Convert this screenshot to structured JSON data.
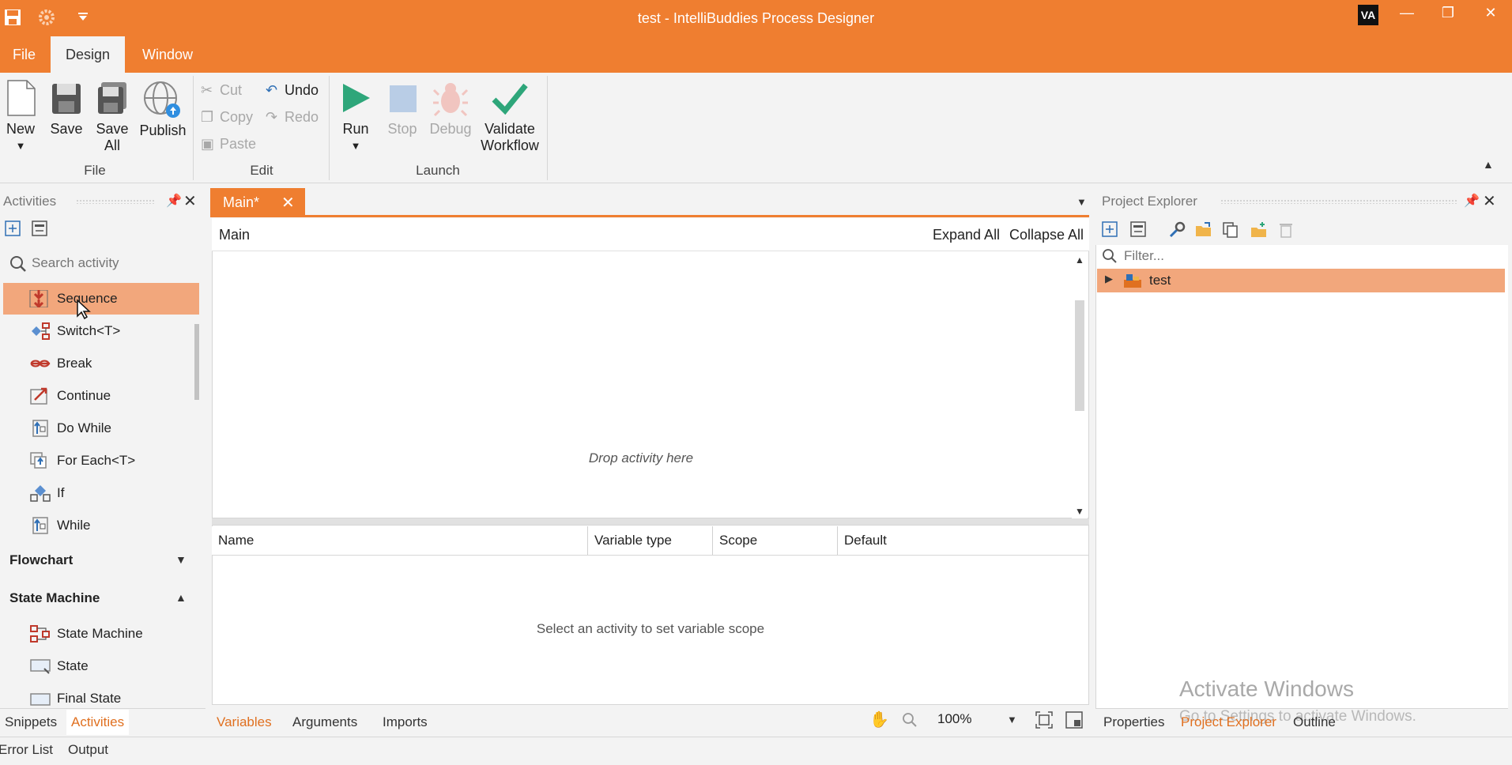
{
  "window": {
    "title": "test - IntelliBuddies Process Designer",
    "user_initials": "VA",
    "accent": "#ef7e30",
    "selection": "#f2a77c"
  },
  "quick_access": [
    "save-icon",
    "gear-icon",
    "dropdown-arrow-icon"
  ],
  "menu": {
    "items": [
      "File",
      "Design",
      "Window"
    ],
    "active": "Design"
  },
  "ribbon": {
    "file_group": {
      "label": "File",
      "new": "New",
      "save": "Save",
      "save_all_1": "Save",
      "save_all_2": "All",
      "publish": "Publish"
    },
    "edit_group": {
      "label": "Edit",
      "cut": "Cut",
      "copy": "Copy",
      "paste": "Paste",
      "undo": "Undo",
      "redo": "Redo"
    },
    "launch_group": {
      "label": "Launch",
      "run": "Run",
      "stop": "Stop",
      "debug": "Debug",
      "validate_1": "Validate",
      "validate_2": "Workflow"
    }
  },
  "activities_panel": {
    "title": "Activities",
    "search_placeholder": "Search activity",
    "items": [
      {
        "label": "Sequence",
        "selected": true
      },
      {
        "label": "Switch<T>"
      },
      {
        "label": "Break"
      },
      {
        "label": "Continue"
      },
      {
        "label": "Do While"
      },
      {
        "label": "For Each<T>"
      },
      {
        "label": "If"
      },
      {
        "label": "While"
      }
    ],
    "categories": {
      "flowchart": "Flowchart",
      "state_machine": "State Machine"
    },
    "state_items": [
      "State Machine",
      "State",
      "Final State"
    ],
    "tabs": [
      "Snippets",
      "Activities"
    ],
    "active_tab": "Activities"
  },
  "designer": {
    "doc_tab": "Main*",
    "breadcrumb": "Main",
    "expand_all": "Expand All",
    "collapse_all": "Collapse All",
    "drop_hint": "Drop activity here",
    "variables": {
      "columns": [
        "Name",
        "Variable type",
        "Scope",
        "Default"
      ],
      "empty_hint": "Select an activity to set variable scope"
    },
    "bottom_tabs": [
      "Variables",
      "Arguments",
      "Imports"
    ],
    "active_bottom_tab": "Variables",
    "zoom": "100%"
  },
  "project_explorer": {
    "title": "Project Explorer",
    "filter_placeholder": "Filter...",
    "tree_root": "test",
    "tabs": [
      "Properties",
      "Project Explorer",
      "Outline"
    ],
    "active_tab": "Project Explorer"
  },
  "status_tabs": [
    "Error List",
    "Output"
  ],
  "watermark": {
    "line1": "Activate Windows",
    "line2": "Go to Settings to activate Windows."
  }
}
